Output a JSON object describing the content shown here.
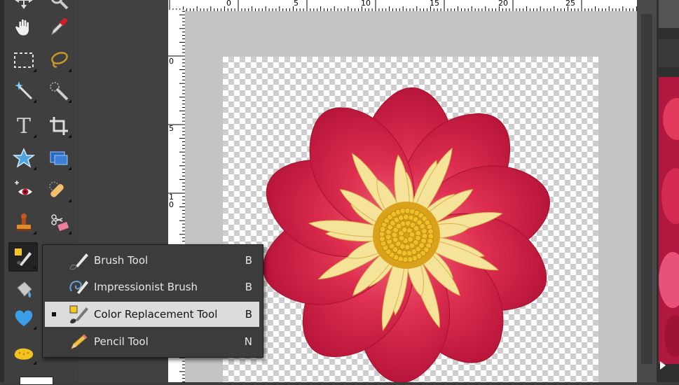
{
  "toolbox": {
    "tools": [
      {
        "name": "move-tool-icon"
      },
      {
        "name": "zoom-tool-icon"
      },
      {
        "name": "hand-tool-icon"
      },
      {
        "name": "eyedropper-tool-icon"
      },
      {
        "name": "marquee-tool-icon"
      },
      {
        "name": "lasso-tool-icon"
      },
      {
        "name": "magic-wand-tool-icon"
      },
      {
        "name": "quick-selection-tool-icon"
      },
      {
        "name": "type-tool-icon",
        "glyph": "T"
      },
      {
        "name": "crop-tool-icon"
      },
      {
        "name": "custom-shape-tool-icon"
      },
      {
        "name": "recompose-tool-icon"
      },
      {
        "name": "red-eye-tool-icon"
      },
      {
        "name": "healing-brush-tool-icon"
      },
      {
        "name": "clone-stamp-tool-icon"
      },
      {
        "name": "eraser-tool-icon"
      },
      {
        "name": "color-replacement-tool-icon"
      },
      {
        "name": "paint-bucket-tool-icon"
      },
      {
        "name": "shape-tool-icon"
      },
      {
        "name": "sponge-tool-icon"
      }
    ]
  },
  "ruler": {
    "top_labels": [
      "0",
      "5",
      "10",
      "15",
      "20",
      "25"
    ],
    "left_labels": [
      "0",
      "5",
      "10"
    ]
  },
  "flyout": {
    "items": [
      {
        "label": "Brush Tool",
        "shortcut": "B",
        "icon": "brush-icon",
        "selected": false
      },
      {
        "label": "Impressionist Brush",
        "shortcut": "B",
        "icon": "impressionist-brush-icon",
        "selected": false
      },
      {
        "label": "Color Replacement Tool",
        "shortcut": "B",
        "icon": "color-replacement-icon",
        "selected": true
      },
      {
        "label": "Pencil Tool",
        "shortcut": "N",
        "icon": "pencil-icon",
        "selected": false
      }
    ]
  },
  "colors": {
    "flower_petal": "#d92a4a",
    "flower_center": "#e0b020",
    "stamen": "#f5e39a",
    "flyout_selected": "#dcdcdc"
  }
}
